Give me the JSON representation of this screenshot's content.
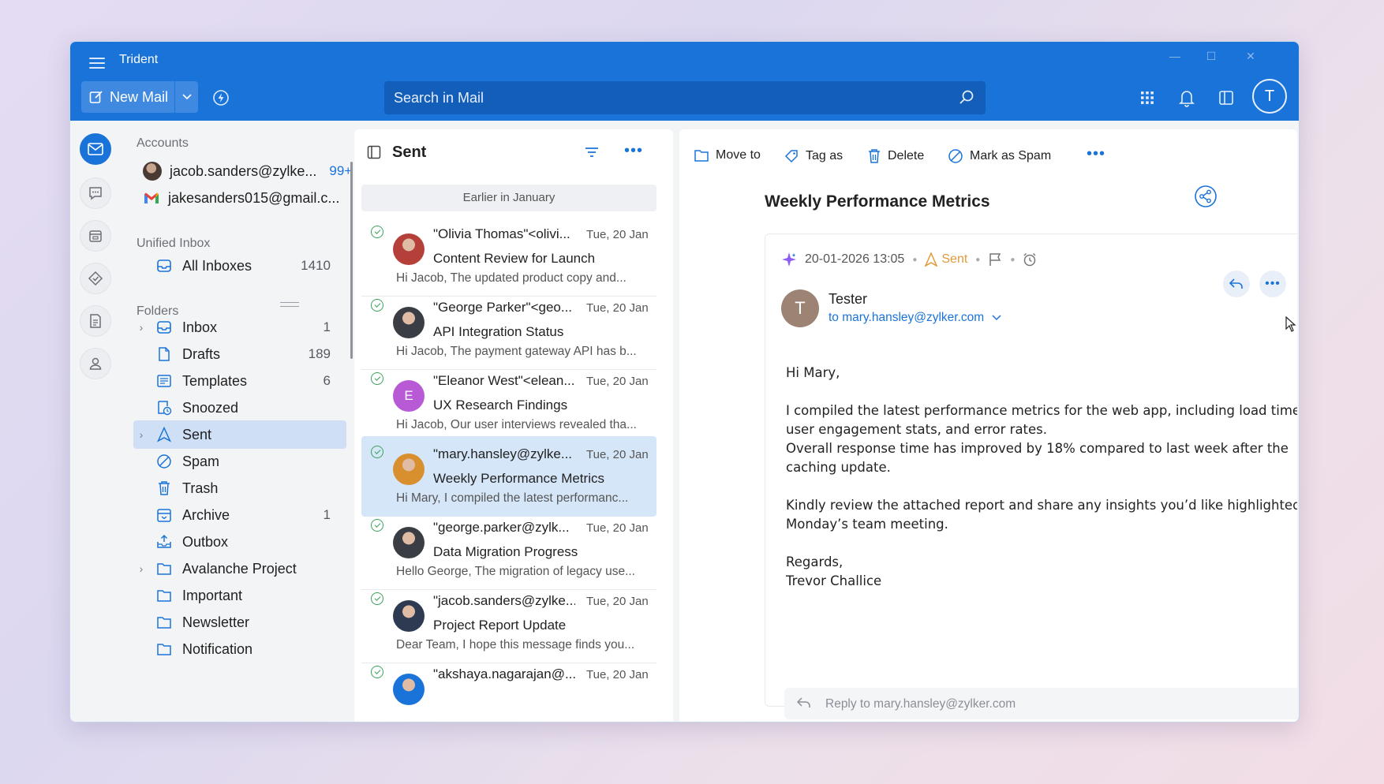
{
  "app": {
    "title": "Trident",
    "new_mail_label": "New Mail",
    "search_placeholder": "Search in Mail",
    "profile_initial": "T"
  },
  "accounts": {
    "heading": "Accounts",
    "items": [
      {
        "email": "jacob.sanders@zylke...",
        "badge": "99+"
      },
      {
        "email": "jakesanders015@gmail.c...",
        "badge": ""
      }
    ]
  },
  "unified": {
    "heading": "Unified Inbox",
    "all_label": "All Inboxes",
    "all_count": "1410"
  },
  "folders": {
    "heading": "Folders",
    "items": [
      {
        "name": "Inbox",
        "count": "1",
        "icon": "inbox-icon",
        "expandable": true
      },
      {
        "name": "Drafts",
        "count": "189",
        "icon": "draft-icon",
        "expandable": false
      },
      {
        "name": "Templates",
        "count": "6",
        "icon": "template-icon",
        "expandable": false
      },
      {
        "name": "Snoozed",
        "count": "",
        "icon": "snooze-icon",
        "expandable": false
      },
      {
        "name": "Sent",
        "count": "",
        "icon": "sent-icon",
        "expandable": true,
        "selected": true
      },
      {
        "name": "Spam",
        "count": "",
        "icon": "spam-icon",
        "expandable": false
      },
      {
        "name": "Trash",
        "count": "",
        "icon": "trash-icon",
        "expandable": false
      },
      {
        "name": "Archive",
        "count": "1",
        "icon": "archive-icon",
        "expandable": false
      },
      {
        "name": "Outbox",
        "count": "",
        "icon": "outbox-icon",
        "expandable": false
      },
      {
        "name": "Avalanche Project",
        "count": "",
        "icon": "folder-icon",
        "expandable": true
      },
      {
        "name": "Important",
        "count": "",
        "icon": "folder-icon",
        "expandable": false
      },
      {
        "name": "Newsletter",
        "count": "",
        "icon": "folder-icon",
        "expandable": false
      },
      {
        "name": "Notification",
        "count": "",
        "icon": "folder-icon",
        "expandable": false
      }
    ]
  },
  "list": {
    "title": "Sent",
    "group_label": "Earlier in January",
    "messages": [
      {
        "from": "\"Olivia Thomas\"<olivi...",
        "date": "Tue, 20 Jan",
        "subject": "Content Review for Launch",
        "preview": "Hi Jacob, The updated product copy and...",
        "avatar": "photo",
        "avatar_color": "#b5403a"
      },
      {
        "from": "\"George Parker\"<geo...",
        "date": "Tue, 20 Jan",
        "subject": "API Integration Status",
        "preview": "Hi Jacob, The payment gateway API has b...",
        "avatar": "photo",
        "avatar_color": "#3b3d45"
      },
      {
        "from": "\"Eleanor West\"<elean...",
        "date": "Tue, 20 Jan",
        "subject": "UX Research Findings",
        "preview": "Hi Jacob, Our user interviews revealed tha...",
        "avatar": "E",
        "avatar_color": "#b85ad6"
      },
      {
        "from": "\"mary.hansley@zylke...",
        "date": "Tue, 20 Jan",
        "subject": "Weekly Performance Metrics",
        "preview": "Hi Mary, I compiled the latest performanc...",
        "avatar": "photo",
        "avatar_color": "#d8902f",
        "selected": true
      },
      {
        "from": "\"george.parker@zylk...",
        "date": "Tue, 20 Jan",
        "subject": "Data Migration Progress",
        "preview": "Hello George, The migration of legacy use...",
        "avatar": "photo",
        "avatar_color": "#3b3d45"
      },
      {
        "from": "\"jacob.sanders@zylke...",
        "date": "Tue, 20 Jan",
        "subject": "Project Report Update",
        "preview": "Dear Team, I hope this message finds you...",
        "avatar": "photo",
        "avatar_color": "#2e3a52"
      },
      {
        "from": "\"akshaya.nagarajan@...",
        "date": "Tue, 20 Jan",
        "subject": "",
        "preview": "",
        "avatar": "photo",
        "avatar_color": "#1a73d9"
      }
    ]
  },
  "toolbar": {
    "move_to": "Move to",
    "tag_as": "Tag as",
    "delete": "Delete",
    "mark_spam": "Mark as Spam"
  },
  "mail": {
    "subject": "Weekly Performance Metrics",
    "datetime": "20-01-2026 13:05",
    "status": "Sent",
    "sender_initial": "T",
    "sender_name": "Tester",
    "to_line": "to mary.hansley@zylker.com",
    "body": [
      "Hi Mary,",
      "",
      "I compiled the latest performance metrics for the web app, including load times, user engagement stats, and error rates.",
      "Overall response time has improved by 18% compared to last week after the caching update.",
      "",
      "Kindly review the attached report and share any insights you’d like highlighted in Monday’s team meeting.",
      "",
      "Regards,",
      "Trevor Challice"
    ],
    "reply_placeholder": "Reply to mary.hansley@zylker.com"
  },
  "colors": {
    "accent": "#1a73d9",
    "titlebar": "#1a73d9",
    "selected_bg": "#d6e6f9",
    "sent_status": "#e39a3b",
    "check_green": "#3aa15a"
  }
}
